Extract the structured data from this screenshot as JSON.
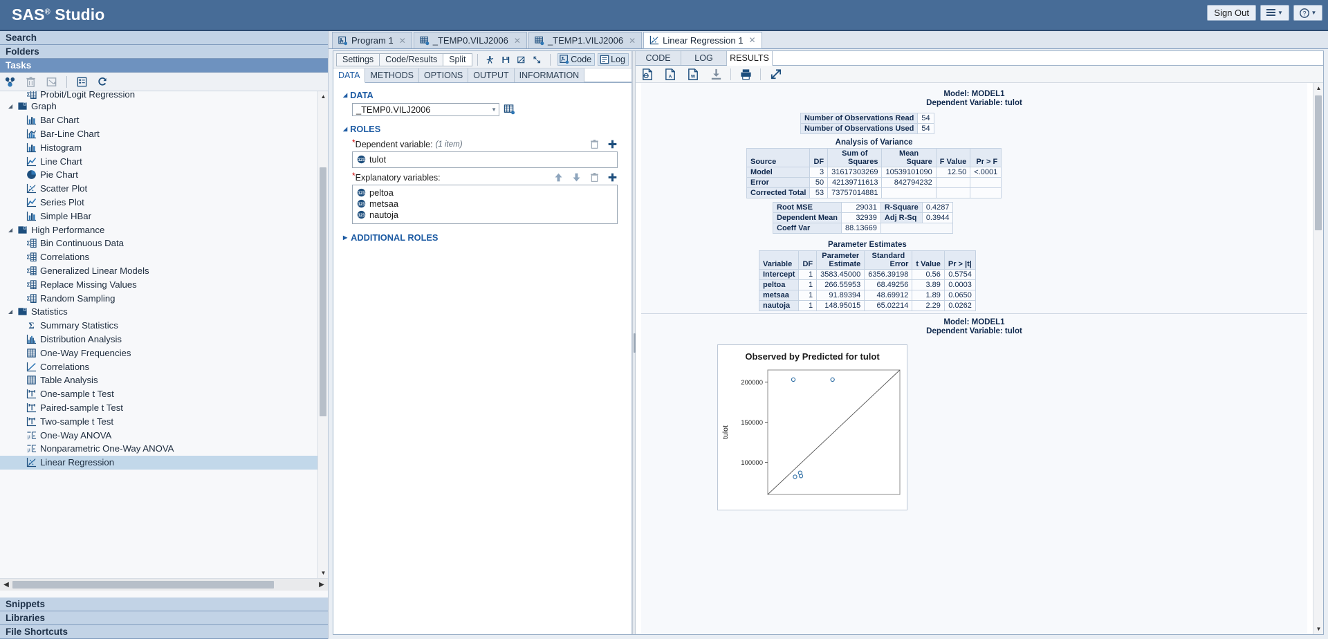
{
  "banner": {
    "logo_text": "SAS",
    "logo_sup": "®",
    "logo_suffix": " Studio",
    "sign_out": "Sign Out",
    "menu_icon": "list-menu-icon",
    "help_icon": "help-question-icon"
  },
  "sidebar": {
    "sections_top": [
      {
        "label": "Search",
        "active": false
      },
      {
        "label": "Folders",
        "active": false
      },
      {
        "label": "Tasks",
        "active": true
      }
    ],
    "sections_bottom": [
      {
        "label": "Snippets"
      },
      {
        "label": "Libraries"
      },
      {
        "label": "File Shortcuts"
      }
    ],
    "toolbar": [
      {
        "name": "new-task-icon",
        "title": "New"
      },
      {
        "name": "delete-icon",
        "title": "Delete"
      },
      {
        "name": "properties-icon",
        "title": "Properties"
      },
      {
        "name": "list-view-icon",
        "title": "List"
      },
      {
        "name": "refresh-icon",
        "title": "Refresh"
      }
    ],
    "tree": [
      {
        "label": "Probit/Logit Regression",
        "level": "child",
        "icon": "stat-table-icon",
        "selected": false,
        "clipped": true
      },
      {
        "label": "Graph",
        "level": "group",
        "icon": "folder-icon",
        "expanded": true
      },
      {
        "label": "Bar Chart",
        "level": "child",
        "icon": "bar-chart-icon"
      },
      {
        "label": "Bar-Line Chart",
        "level": "child",
        "icon": "bar-line-chart-icon"
      },
      {
        "label": "Histogram",
        "level": "child",
        "icon": "bar-chart-icon"
      },
      {
        "label": "Line Chart",
        "level": "child",
        "icon": "line-chart-icon"
      },
      {
        "label": "Pie Chart",
        "level": "child",
        "icon": "pie-chart-icon"
      },
      {
        "label": "Scatter Plot",
        "level": "child",
        "icon": "scatter-plot-icon"
      },
      {
        "label": "Series Plot",
        "level": "child",
        "icon": "line-chart-icon"
      },
      {
        "label": "Simple HBar",
        "level": "child",
        "icon": "bar-chart-icon"
      },
      {
        "label": "High Performance",
        "level": "group",
        "icon": "folder-icon",
        "expanded": true
      },
      {
        "label": "Bin Continuous Data",
        "level": "child",
        "icon": "stat-table-icon"
      },
      {
        "label": "Correlations",
        "level": "child",
        "icon": "stat-table-icon"
      },
      {
        "label": "Generalized Linear Models",
        "level": "child",
        "icon": "stat-table-icon"
      },
      {
        "label": "Replace Missing Values",
        "level": "child",
        "icon": "stat-table-icon"
      },
      {
        "label": "Random Sampling",
        "level": "child",
        "icon": "stat-table-icon"
      },
      {
        "label": "Statistics",
        "level": "group",
        "icon": "folder-icon",
        "expanded": true
      },
      {
        "label": "Summary Statistics",
        "level": "child",
        "icon": "sigma-icon"
      },
      {
        "label": "Distribution Analysis",
        "level": "child",
        "icon": "histogram-icon"
      },
      {
        "label": "One-Way Frequencies",
        "level": "child",
        "icon": "grid-table-icon"
      },
      {
        "label": "Correlations",
        "level": "child",
        "icon": "scatter-line-icon"
      },
      {
        "label": "Table Analysis",
        "level": "child",
        "icon": "grid-table-icon"
      },
      {
        "label": "One-sample t Test",
        "level": "child",
        "icon": "ttest-icon"
      },
      {
        "label": "Paired-sample t Test",
        "level": "child",
        "icon": "ttest-icon"
      },
      {
        "label": "Two-sample t Test",
        "level": "child",
        "icon": "ttest-icon"
      },
      {
        "label": "One-Way ANOVA",
        "level": "child",
        "icon": "anova-icon"
      },
      {
        "label": "Nonparametric One-Way ANOVA",
        "level": "child",
        "icon": "anova-icon"
      },
      {
        "label": "Linear Regression",
        "level": "child",
        "icon": "scatter-plot-icon",
        "selected": true
      }
    ]
  },
  "workspace": {
    "tabs": [
      {
        "label": "Program 1",
        "icon": "sas-program-icon",
        "active": false,
        "closable": true
      },
      {
        "label": "_TEMP0.VILJ2006",
        "icon": "dataset-icon",
        "active": false,
        "closable": true
      },
      {
        "label": "_TEMP1.VILJ2006",
        "icon": "dataset-icon",
        "active": false,
        "closable": true
      },
      {
        "label": "Linear Regression 1",
        "icon": "scatter-plot-icon",
        "active": true,
        "closable": true
      }
    ]
  },
  "task_toolbar": {
    "segments": [
      {
        "label": "Settings",
        "active": false
      },
      {
        "label": "Code/Results",
        "active": false
      },
      {
        "label": "Split",
        "active": true
      }
    ],
    "icons": [
      {
        "name": "run-icon",
        "title": "Run"
      },
      {
        "name": "save-icon",
        "title": "Save"
      },
      {
        "name": "reset-icon",
        "title": "Reset"
      },
      {
        "name": "maximize-icon",
        "title": "Maximize view"
      }
    ],
    "buttons": [
      {
        "label": "Code",
        "icon": "code-icon"
      },
      {
        "label": "Log",
        "icon": "log-icon"
      }
    ]
  },
  "task_form": {
    "tabs": [
      {
        "label": "DATA",
        "active": true
      },
      {
        "label": "METHODS",
        "active": false
      },
      {
        "label": "OPTIONS",
        "active": false
      },
      {
        "label": "OUTPUT",
        "active": false
      },
      {
        "label": "INFORMATION",
        "active": false
      }
    ],
    "data_section": {
      "title": "DATA",
      "dataset_value": "_TEMP0.VILJ2006",
      "browse_icon": "select-table-icon"
    },
    "roles_section": {
      "title": "ROLES",
      "dependent": {
        "label": "Dependent variable:",
        "hint": "(1 item)",
        "required": true,
        "items": [
          {
            "name": "tulot",
            "type_icon": "numeric-123-icon"
          }
        ],
        "actions": [
          {
            "name": "delete-dependent-icon",
            "glyph": "trash"
          },
          {
            "name": "add-dependent-icon",
            "glyph": "plus"
          }
        ]
      },
      "explanatory": {
        "label": "Explanatory variables:",
        "required": true,
        "items": [
          {
            "name": "peltoa",
            "type_icon": "numeric-123-icon"
          },
          {
            "name": "metsaa",
            "type_icon": "numeric-123-icon"
          },
          {
            "name": "nautoja",
            "type_icon": "numeric-123-icon"
          }
        ],
        "actions": [
          {
            "name": "move-up-icon",
            "glyph": "up"
          },
          {
            "name": "move-down-icon",
            "glyph": "down"
          },
          {
            "name": "delete-explanatory-icon",
            "glyph": "trash"
          },
          {
            "name": "add-explanatory-icon",
            "glyph": "plus"
          }
        ]
      },
      "additional_roles": "ADDITIONAL ROLES"
    }
  },
  "results": {
    "tabs": [
      {
        "label": "CODE",
        "active": false
      },
      {
        "label": "LOG",
        "active": false
      },
      {
        "label": "RESULTS",
        "active": true
      }
    ],
    "toolbar": [
      {
        "name": "export-html-icon"
      },
      {
        "name": "export-pdf-icon"
      },
      {
        "name": "export-word-icon"
      },
      {
        "name": "download-icon"
      },
      {
        "name": "print-icon"
      },
      {
        "name": "open-new-window-icon"
      }
    ],
    "model_header": {
      "line1": "Model: MODEL1",
      "line2": "Dependent Variable: tulot"
    },
    "observations": {
      "rows": [
        {
          "label": "Number of Observations Read",
          "value": "54"
        },
        {
          "label": "Number of Observations Used",
          "value": "54"
        }
      ]
    },
    "anova": {
      "caption": "Analysis of Variance",
      "headers": [
        "Source",
        "DF",
        "Sum of Squares",
        "Mean Square",
        "F Value",
        "Pr > F"
      ],
      "rows": [
        [
          "Model",
          "3",
          "31617303269",
          "10539101090",
          "12.50",
          "<.0001"
        ],
        [
          "Error",
          "50",
          "42139711613",
          "842794232",
          "",
          ""
        ],
        [
          "Corrected Total",
          "53",
          "73757014881",
          "",
          "",
          ""
        ]
      ]
    },
    "fitstats": {
      "rows": [
        [
          "Root MSE",
          "29031",
          "R-Square",
          "0.4287"
        ],
        [
          "Dependent Mean",
          "32939",
          "Adj R-Sq",
          "0.3944"
        ],
        [
          "Coeff Var",
          "88.13669",
          "",
          ""
        ]
      ]
    },
    "parameter_estimates": {
      "caption": "Parameter Estimates",
      "headers": [
        "Variable",
        "DF",
        "Parameter Estimate",
        "Standard Error",
        "t Value",
        "Pr > |t|"
      ],
      "rows": [
        [
          "Intercept",
          "1",
          "3583.45000",
          "6356.39198",
          "0.56",
          "0.5754"
        ],
        [
          "peltoa",
          "1",
          "266.55953",
          "68.49256",
          "3.89",
          "0.0003"
        ],
        [
          "metsaa",
          "1",
          "91.89394",
          "48.69912",
          "1.89",
          "0.0650"
        ],
        [
          "nautoja",
          "1",
          "148.95015",
          "65.02214",
          "2.29",
          "0.0262"
        ]
      ]
    },
    "model_header2": {
      "line1": "Model: MODEL1",
      "line2": "Dependent Variable: tulot"
    },
    "chart_data": {
      "type": "scatter",
      "title": "Observed by Predicted for tulot",
      "xlabel": "",
      "ylabel": "tulot",
      "ylim": [
        60000,
        215000
      ],
      "yticks": [
        100000,
        150000,
        200000
      ],
      "ytick_labels": [
        "100000",
        "150000",
        "200000"
      ],
      "xlim": [
        60000,
        215000
      ],
      "grid": false,
      "reference_line": {
        "type": "identity",
        "label": "y = x"
      },
      "points": [
        {
          "x": 90000,
          "y": 203000
        },
        {
          "x": 136000,
          "y": 203000
        },
        {
          "x": 98000,
          "y": 87000
        },
        {
          "x": 92000,
          "y": 82000
        },
        {
          "x": 99000,
          "y": 83000
        }
      ]
    }
  }
}
